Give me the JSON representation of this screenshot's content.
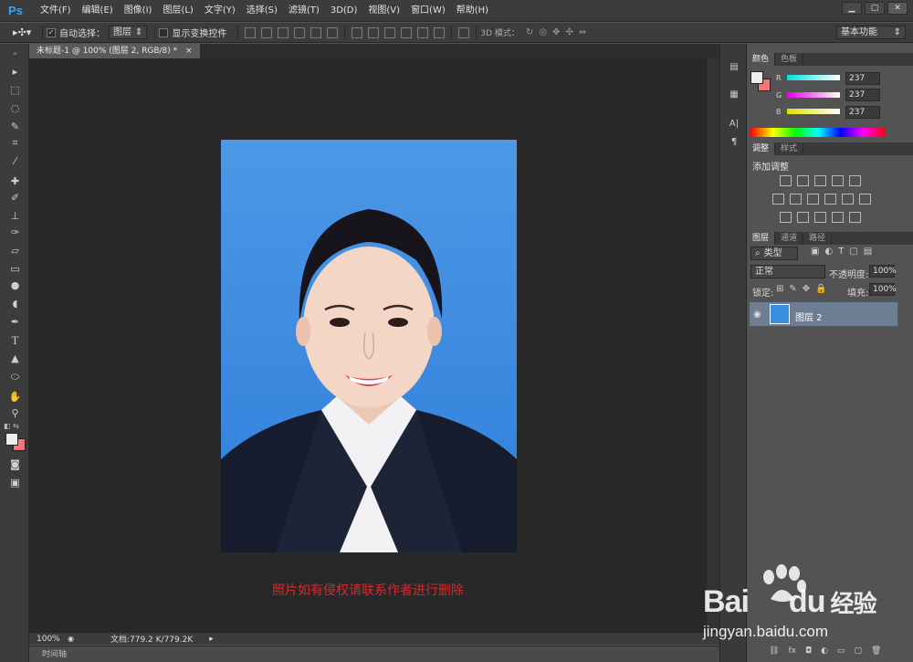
{
  "menubar": {
    "logo": "Ps",
    "items": [
      "文件(F)",
      "编辑(E)",
      "图像(I)",
      "图层(L)",
      "文字(Y)",
      "选择(S)",
      "滤镜(T)",
      "3D(D)",
      "视图(V)",
      "窗口(W)",
      "帮助(H)"
    ],
    "window_buttons": [
      "▁",
      "▢",
      "✕"
    ]
  },
  "options": {
    "auto_select_label": "自动选择：",
    "auto_select_value": "图层",
    "show_transform_label": "显示变换控件",
    "mode_3d_label": "3D 模式：",
    "workspace": "基本功能"
  },
  "document": {
    "tab_title": "未标题-1 @ 100% (图层 2, RGB/8) *",
    "zoom": "100%",
    "doc_info": "文档:779.2 K/779.2K",
    "timeline_label": "时间轴"
  },
  "overlay": {
    "notice": "照片如有侵权请联系作者进行删除"
  },
  "color_panel": {
    "tabs": [
      "颜色",
      "色板"
    ],
    "channels": [
      {
        "label": "R",
        "value": "237",
        "color": "#00e0e0"
      },
      {
        "label": "G",
        "value": "237",
        "color": "#e000e0"
      },
      {
        "label": "B",
        "value": "237",
        "color": "#e0e000"
      }
    ],
    "foreground": "#ededed",
    "background": "#e87a7a"
  },
  "adjust_panel": {
    "tabs": [
      "调整",
      "样式"
    ],
    "title": "添加调整"
  },
  "layers_panel": {
    "tabs": [
      "图层",
      "通道",
      "路径"
    ],
    "filter_label": "类型",
    "blend_mode": "正常",
    "opacity_label": "不透明度:",
    "opacity_value": "100%",
    "lock_label": "锁定:",
    "fill_label": "填充:",
    "fill_value": "100%",
    "layers": [
      {
        "name": "图层 2",
        "visible": true
      }
    ]
  },
  "branding": {
    "baidu_text": "Bai",
    "baidu_du": "du",
    "jingyan_cn": "经验",
    "url": "jingyan.baidu.com"
  },
  "colors": {
    "photo_background": "#3a8ee0",
    "accent_layer": "#6d7d92",
    "notice_red": "#d9282c"
  }
}
